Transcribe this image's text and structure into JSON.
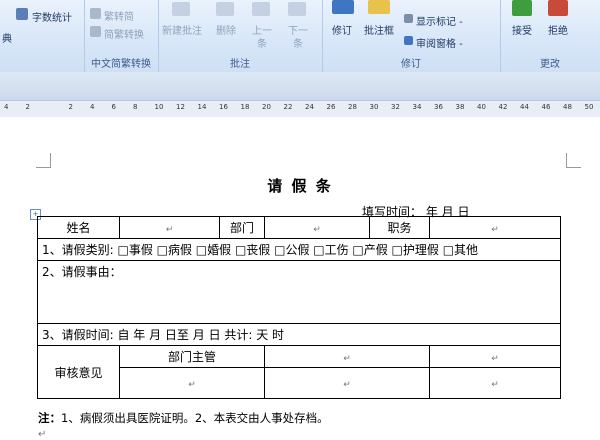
{
  "ribbon": {
    "groups": [
      {
        "label": ""
      },
      {
        "label": "中文简繁转换"
      },
      {
        "label": "批注"
      },
      {
        "label": "修订"
      },
      {
        "label": "更改"
      }
    ],
    "left_partial_label": "典",
    "word_count": "字数统计",
    "trad_to_simp": "繁转简",
    "simp_to_trad": "简转繁",
    "convert_simp_trad": "简繁转换",
    "new_comment": "新建批注",
    "delete": "删除",
    "previous": "上一",
    "previous2": "条",
    "next": "下一",
    "next2": "条",
    "track_changes": "修订",
    "comment_box": "批注框",
    "show_markup": "显示标记 -",
    "review_pane": "审阅窗格 -",
    "accept": "接受",
    "reject": "拒绝",
    "accent_color": "#2c5aa0"
  },
  "ruler": {
    "ticks": [
      "4",
      "2",
      "",
      "2",
      "4",
      "6",
      "8",
      "10",
      "12",
      "14",
      "16",
      "18",
      "20",
      "22",
      "24",
      "26",
      "28",
      "30",
      "32",
      "34",
      "36",
      "38",
      "40",
      "42",
      "44",
      "46",
      "48",
      "50"
    ]
  },
  "document": {
    "title": "请    假    条",
    "fill_time": "填写时间：         年     月     日",
    "row1": {
      "name_label": "姓名",
      "dept_label": "部门",
      "position_label": "职务"
    },
    "row2": "1、请假类别: □事假  □病假  □婚假  □丧假  □公假  □工伤  □产假  □护理假  □其他",
    "row3": "2、请假事由：",
    "row4": "3、请假时间: 自         年     月     日至     月     日        共计:        天      时",
    "row5": {
      "audit_label": "审核意见",
      "dept_head": "部门主管"
    },
    "note_bold": "注：",
    "note_text": "1、病假须出具医院证明。2、本表交由人事处存档。",
    "para_mark": "↵"
  }
}
